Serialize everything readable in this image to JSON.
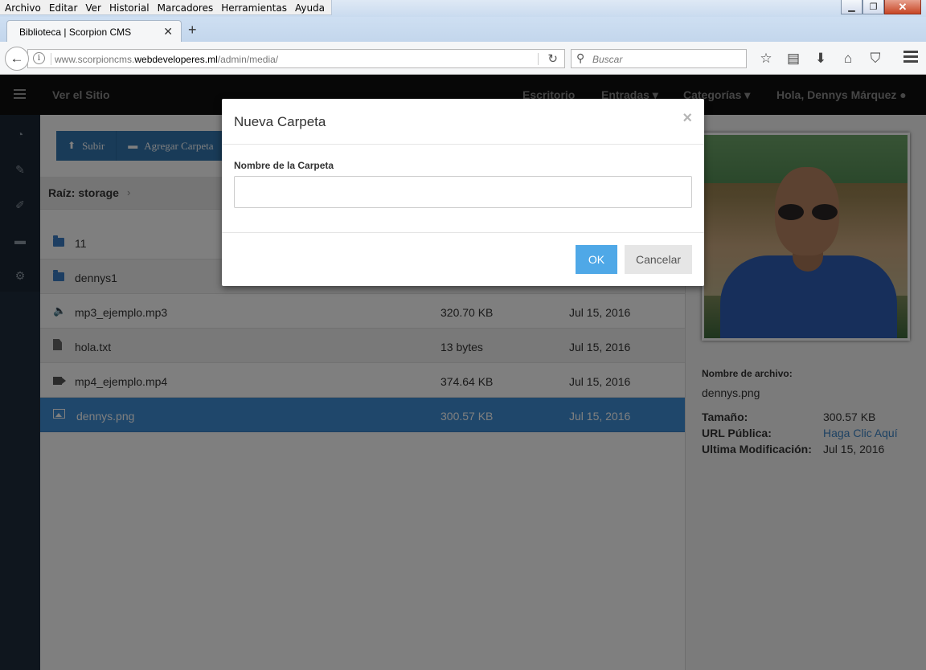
{
  "browser": {
    "menu": [
      "Archivo",
      "Editar",
      "Ver",
      "Historial",
      "Marcadores",
      "Herramientas",
      "Ayuda"
    ],
    "tab_title": "Biblioteca | Scorpion CMS",
    "url_prefix": "www.scorpioncms.",
    "url_domain": "webdeveloperes.ml",
    "url_path": "/admin/media/",
    "search_placeholder": "Buscar",
    "icons": [
      "star-icon",
      "reader-icon",
      "download-icon",
      "home-icon",
      "pocket-icon",
      "hamburger-icon"
    ]
  },
  "topbar": {
    "site_link": "Ver el Sitio",
    "nav": [
      "Escritorio",
      "Entradas",
      "Categorías",
      "Hola, Dennys Márquez"
    ]
  },
  "sidebar": [
    "dashboard-icon",
    "edit-icon",
    "brush-icon",
    "folder-open-icon",
    "gear-icon"
  ],
  "toolbar": {
    "upload_label": "Subir",
    "add_folder_label": "Agregar Carpeta"
  },
  "breadcrumb": {
    "label": "Raíz: storage"
  },
  "files": [
    {
      "name": "11",
      "type": "folder",
      "size": "",
      "date": ""
    },
    {
      "name": "dennys1",
      "type": "folder",
      "size": "",
      "date": ""
    },
    {
      "name": "mp3_ejemplo.mp3",
      "type": "audio",
      "size": "320.70 KB",
      "date": "Jul 15, 2016"
    },
    {
      "name": "hola.txt",
      "type": "file",
      "size": "13 bytes",
      "date": "Jul 15, 2016"
    },
    {
      "name": "mp4_ejemplo.mp4",
      "type": "video",
      "size": "374.64 KB",
      "date": "Jul 15, 2016"
    },
    {
      "name": "dennys.png",
      "type": "image",
      "size": "300.57 KB",
      "date": "Jul 15, 2016",
      "selected": true
    }
  ],
  "details": {
    "filename_label": "Nombre de archivo:",
    "filename": "dennys.png",
    "size_label": "Tamaño:",
    "size": "300.57 KB",
    "url_label": "URL Pública:",
    "url_link": "Haga Clic Aquí",
    "modified_label": "Ultima Modificación:",
    "modified": "Jul 15, 2016"
  },
  "modal": {
    "title": "Nueva Carpeta",
    "close": "×",
    "field_label": "Nombre de la Carpeta",
    "field_value": "",
    "ok_label": "OK",
    "cancel_label": "Cancelar"
  }
}
